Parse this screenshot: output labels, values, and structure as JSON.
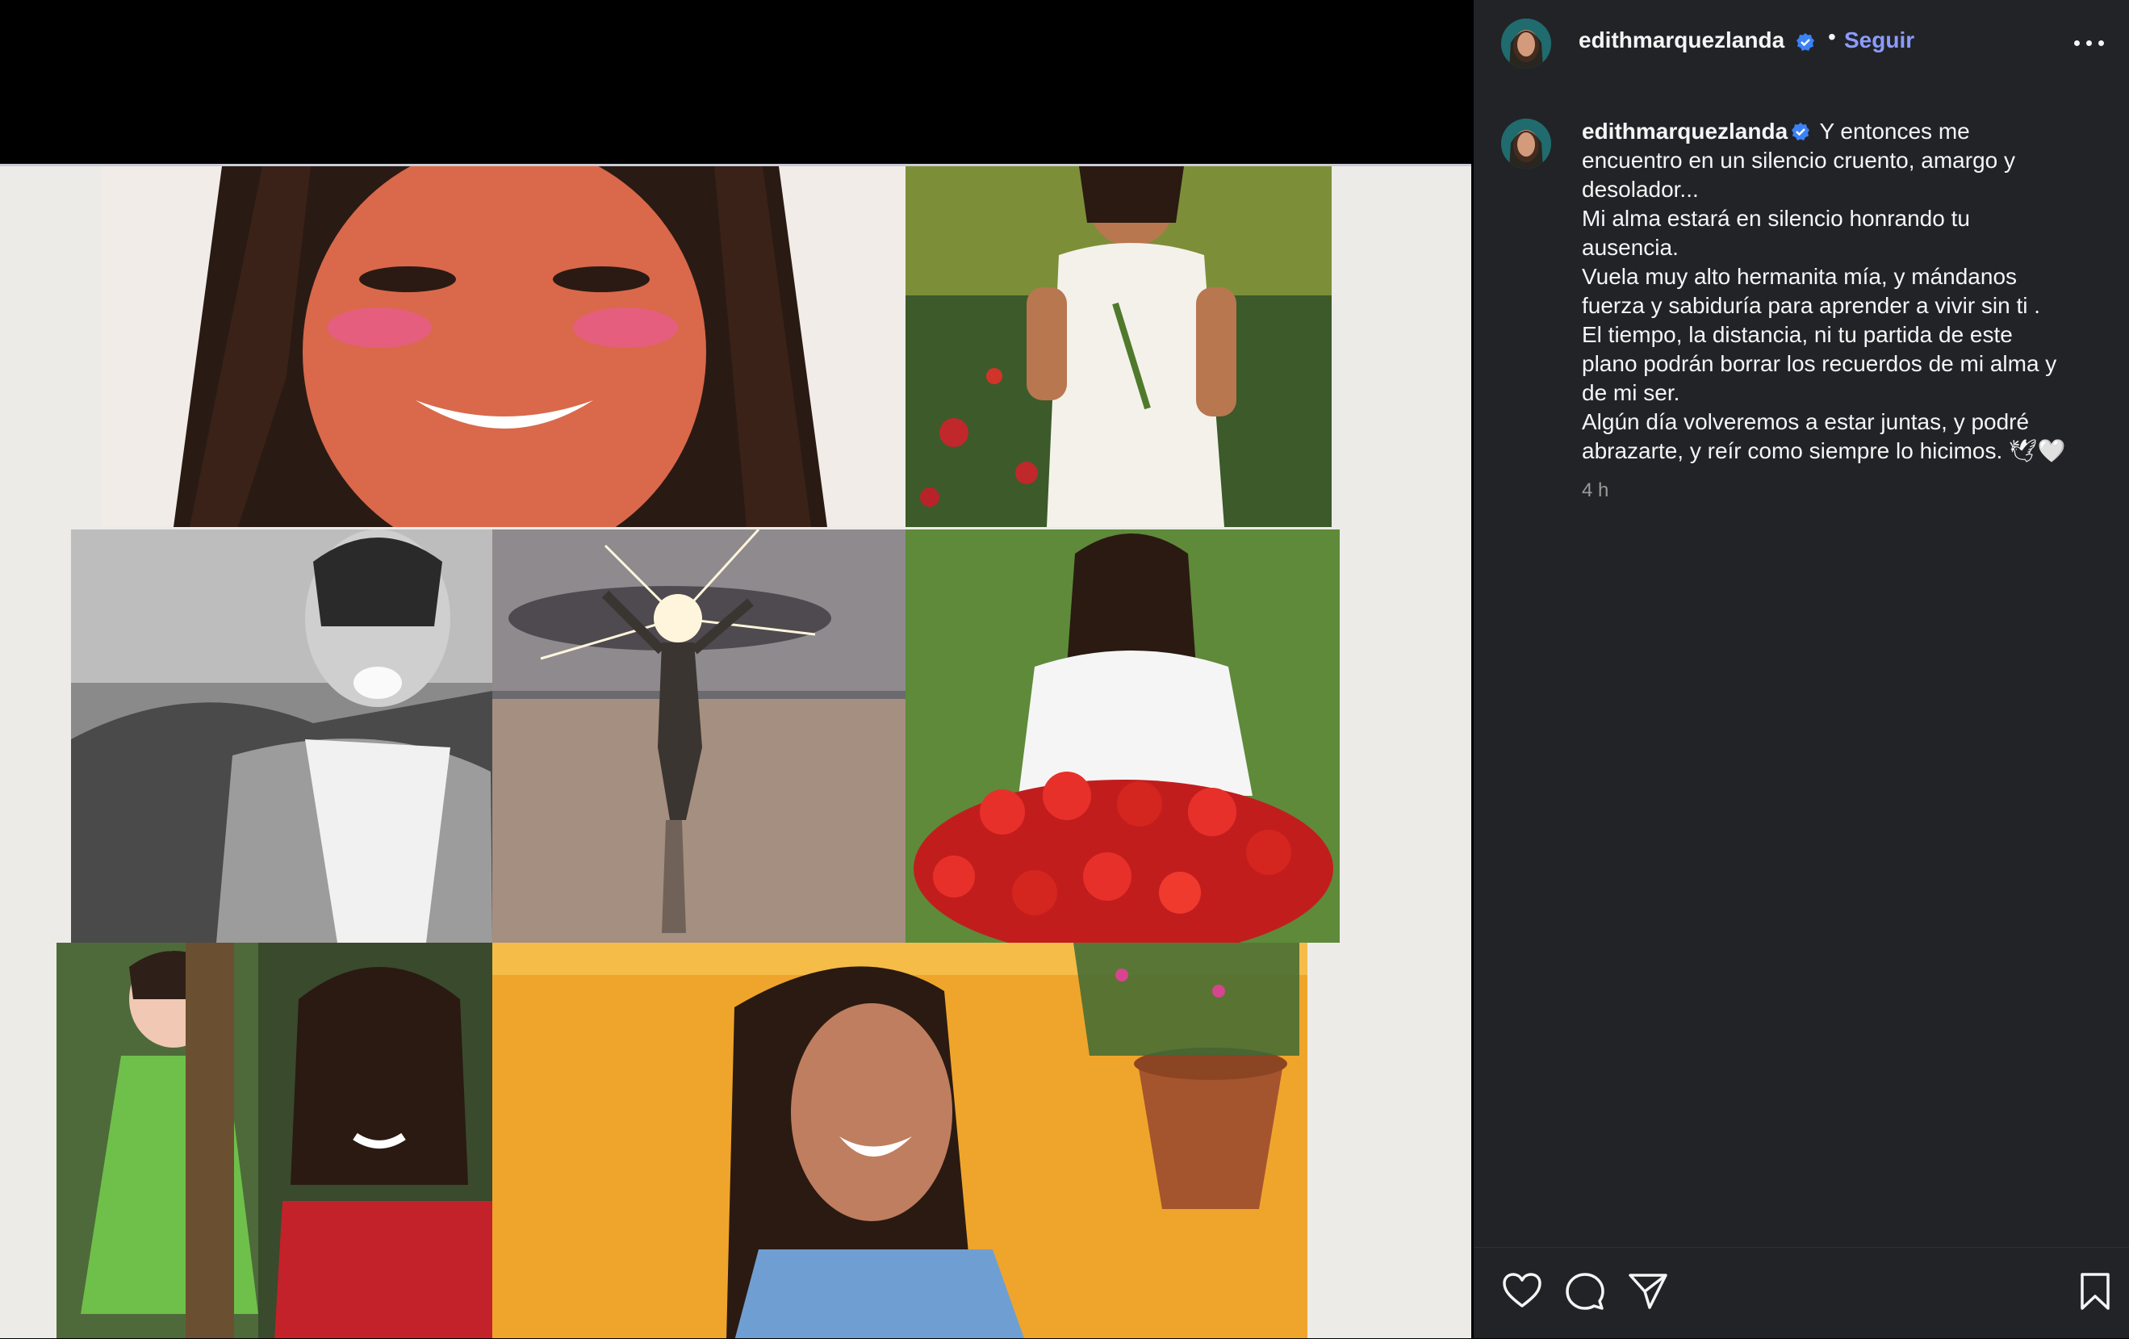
{
  "post": {
    "username": "edithmarquezlanda",
    "follow_label": "Seguir",
    "separator": "•",
    "caption_lines": [
      "Y entonces me",
      "encuentro en un silencio cruento, amargo y",
      "desolador...",
      "Mi alma estará en silencio honrando tu",
      "ausencia.",
      "Vuela muy alto hermanita mía, y mándanos",
      "fuerza y sabiduría para aprender a vivir sin ti .",
      "El tiempo, la distancia, ni tu partida de este",
      "plano podrán borrar los recuerdos de mi alma y",
      "de mi ser.",
      "Algún día volveremos a estar juntas, y podré",
      "abrazarte, y reír como siempre lo hicimos. 🕊🤍"
    ],
    "timestamp": "4 h"
  },
  "icons": {
    "verified": "verified-badge-icon",
    "more": "more-options-icon",
    "like": "heart-icon",
    "comment": "comment-icon",
    "share": "share-icon",
    "save": "bookmark-icon"
  },
  "colors": {
    "panel_bg": "#222327",
    "follow": "#8c9bff",
    "verified": "#3b82f6",
    "text": "#f5f5f5",
    "muted": "#9a9a9a"
  }
}
